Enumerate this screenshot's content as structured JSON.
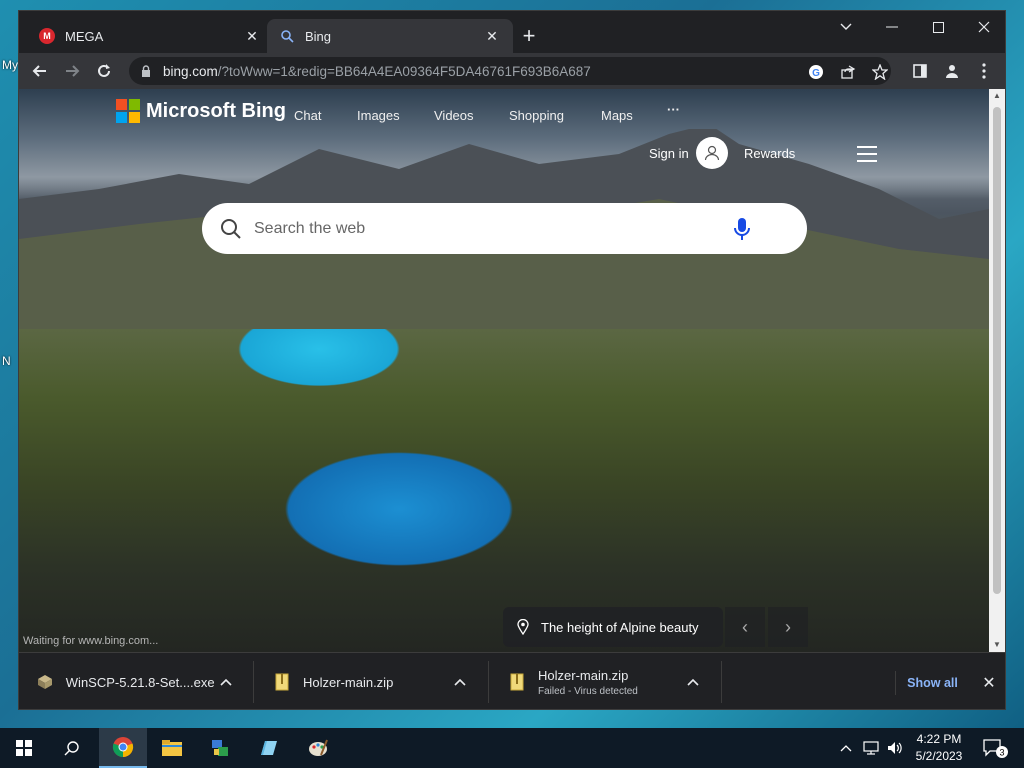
{
  "desktop": {
    "labels": [
      "My",
      "N"
    ]
  },
  "tabs": [
    {
      "title": "MEGA",
      "icon": "mega-icon"
    },
    {
      "title": "Bing",
      "icon": "bing-search-icon"
    }
  ],
  "address": {
    "host": "bing.com",
    "path": "/?toWww=1&redig=BB64A4EA09364F5DA46761F693B6A687"
  },
  "bing": {
    "brand": "Microsoft Bing",
    "nav": [
      "Chat",
      "Images",
      "Videos",
      "Shopping",
      "Maps",
      "···"
    ],
    "sign_in": "Sign in",
    "rewards": "Rewards",
    "search_placeholder": "Search the web",
    "caption": "The height of Alpine beauty",
    "status": "Waiting for www.bing.com..."
  },
  "downloads": {
    "items": [
      {
        "name": "WinSCP-5.21.8-Set....exe",
        "sub": ""
      },
      {
        "name": "Holzer-main.zip",
        "sub": ""
      },
      {
        "name": "Holzer-main.zip",
        "sub": "Failed - Virus detected"
      }
    ],
    "show_all": "Show all"
  },
  "taskbar": {
    "time": "4:22 PM",
    "date": "5/2/2023",
    "notification_count": "3"
  },
  "colors": {
    "accent": "#8ab4f8",
    "mega_red": "#d9272e"
  }
}
